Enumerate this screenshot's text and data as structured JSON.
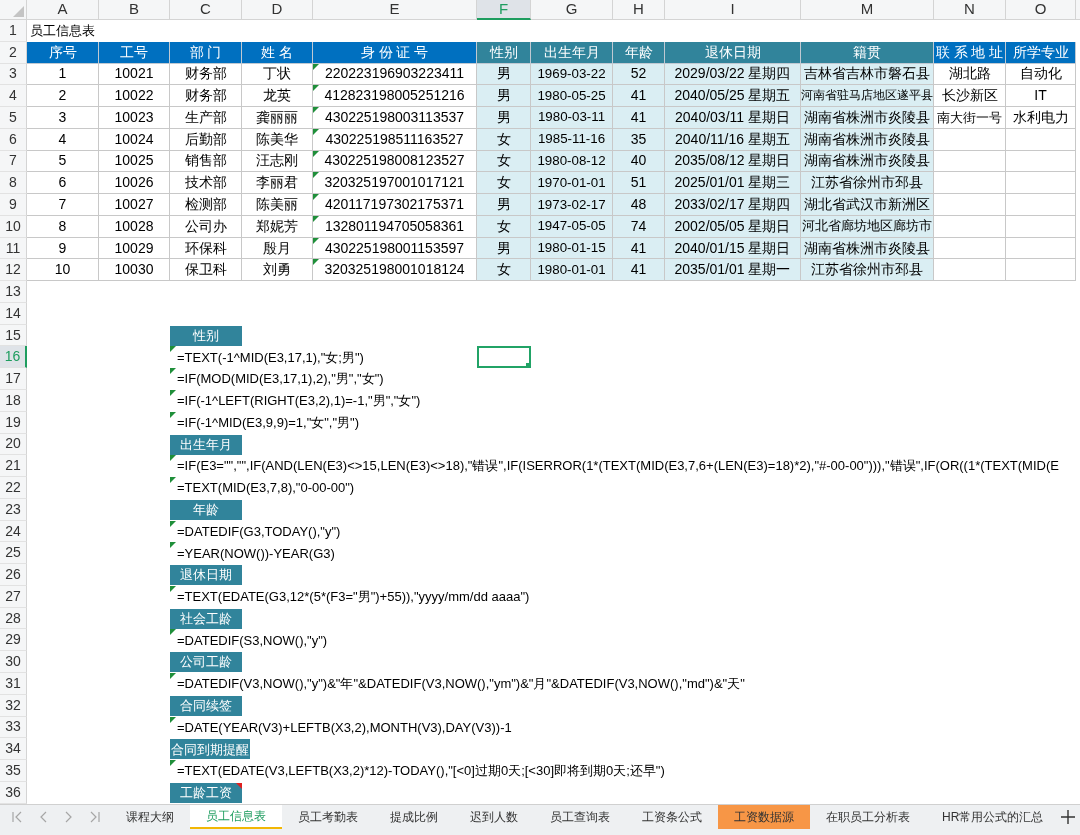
{
  "column_headers": [
    {
      "label": "A",
      "selected": false
    },
    {
      "label": "B",
      "selected": false
    },
    {
      "label": "C",
      "selected": false
    },
    {
      "label": "D",
      "selected": false
    },
    {
      "label": "E",
      "selected": false
    },
    {
      "label": "F",
      "selected": true
    },
    {
      "label": "G",
      "selected": false
    },
    {
      "label": "H",
      "selected": false
    },
    {
      "label": "I",
      "selected": false
    },
    {
      "label": "M",
      "selected": false
    },
    {
      "label": "N",
      "selected": false
    },
    {
      "label": "O",
      "selected": false
    }
  ],
  "row_headers": [
    {
      "label": "1",
      "selected": false
    },
    {
      "label": "2",
      "selected": false
    },
    {
      "label": "3",
      "selected": false
    },
    {
      "label": "4",
      "selected": false
    },
    {
      "label": "5",
      "selected": false
    },
    {
      "label": "6",
      "selected": false
    },
    {
      "label": "7",
      "selected": false
    },
    {
      "label": "8",
      "selected": false
    },
    {
      "label": "9",
      "selected": false
    },
    {
      "label": "10",
      "selected": false
    },
    {
      "label": "11",
      "selected": false
    },
    {
      "label": "12",
      "selected": false
    },
    {
      "label": "13",
      "selected": false
    },
    {
      "label": "14",
      "selected": false
    },
    {
      "label": "15",
      "selected": false
    },
    {
      "label": "16",
      "selected": true
    },
    {
      "label": "17",
      "selected": false
    },
    {
      "label": "18",
      "selected": false
    },
    {
      "label": "19",
      "selected": false
    },
    {
      "label": "20",
      "selected": false
    },
    {
      "label": "21",
      "selected": false
    },
    {
      "label": "22",
      "selected": false
    },
    {
      "label": "23",
      "selected": false
    },
    {
      "label": "24",
      "selected": false
    },
    {
      "label": "25",
      "selected": false
    },
    {
      "label": "26",
      "selected": false
    },
    {
      "label": "27",
      "selected": false
    },
    {
      "label": "28",
      "selected": false
    },
    {
      "label": "29",
      "selected": false
    },
    {
      "label": "30",
      "selected": false
    },
    {
      "label": "31",
      "selected": false
    },
    {
      "label": "32",
      "selected": false
    },
    {
      "label": "33",
      "selected": false
    },
    {
      "label": "34",
      "selected": false
    },
    {
      "label": "35",
      "selected": false
    },
    {
      "label": "36",
      "selected": false
    }
  ],
  "sheet_title": "员工信息表",
  "table": {
    "columns": [
      {
        "label": "序号",
        "kind": "input",
        "flagged": false
      },
      {
        "label": "工号",
        "kind": "input",
        "flagged": false
      },
      {
        "label": "部 门",
        "kind": "input",
        "flagged": false
      },
      {
        "label": "姓 名",
        "kind": "input",
        "flagged": false
      },
      {
        "label": "身 份 证 号",
        "kind": "input",
        "flagged": true
      },
      {
        "label": "性别",
        "kind": "calculated",
        "flagged": false
      },
      {
        "label": "出生年月",
        "kind": "calculated",
        "flagged": false
      },
      {
        "label": "年龄",
        "kind": "calculated",
        "flagged": false
      },
      {
        "label": "退休日期",
        "kind": "calculated",
        "flagged": false
      },
      {
        "label": "籍贯",
        "kind": "calculated",
        "flagged": false
      },
      {
        "label": "联 系 地 址",
        "kind": "input",
        "flagged": false
      },
      {
        "label": "所学专业",
        "kind": "input",
        "flagged": false
      }
    ],
    "rows": [
      {
        "cells": [
          "1",
          "10021",
          "财务部",
          "丁状",
          "220223196903223411",
          "男",
          "1969-03-22",
          "52",
          "2029/03/22 星期四",
          "吉林省吉林市磐石县",
          "湖北路",
          "自动化"
        ]
      },
      {
        "cells": [
          "2",
          "10022",
          "财务部",
          "龙英",
          "412823198005251216",
          "男",
          "1980-05-25",
          "41",
          "2040/05/25 星期五",
          "河南省驻马店地区遂平县",
          "长沙新区",
          "IT"
        ]
      },
      {
        "cells": [
          "3",
          "10023",
          "生产部",
          "龚丽丽",
          "430225198003113537",
          "男",
          "1980-03-11",
          "41",
          "2040/03/11 星期日",
          "湖南省株洲市炎陵县",
          "南大街一号",
          "水利电力"
        ]
      },
      {
        "cells": [
          "4",
          "10024",
          "后勤部",
          "陈美华",
          "430225198511163527",
          "女",
          "1985-11-16",
          "35",
          "2040/11/16 星期五",
          "湖南省株洲市炎陵县"
        ]
      },
      {
        "cells": [
          "5",
          "10025",
          "销售部",
          "汪志刚",
          "430225198008123527",
          "女",
          "1980-08-12",
          "40",
          "2035/08/12 星期日",
          "湖南省株洲市炎陵县"
        ]
      },
      {
        "cells": [
          "6",
          "10026",
          "技术部",
          "李丽君",
          "320325197001017121",
          "女",
          "1970-01-01",
          "51",
          "2025/01/01 星期三",
          "江苏省徐州市邳县"
        ]
      },
      {
        "cells": [
          "7",
          "10027",
          "检测部",
          "陈美丽",
          "420117197302175371",
          "男",
          "1973-02-17",
          "48",
          "2033/02/17 星期四",
          "湖北省武汉市新洲区"
        ]
      },
      {
        "cells": [
          "8",
          "10028",
          "公司办",
          "郑妮芳",
          "132801194705058361",
          "女",
          "1947-05-05",
          "74",
          "2002/05/05 星期日",
          "河北省廊坊地区廊坊市"
        ]
      },
      {
        "cells": [
          "9",
          "10029",
          "环保科",
          "殷月",
          "430225198001153597",
          "男",
          "1980-01-15",
          "41",
          "2040/01/15 星期日",
          "湖南省株洲市炎陵县"
        ]
      },
      {
        "cells": [
          "10",
          "10030",
          "保卫科",
          "刘勇",
          "320325198001018124",
          "女",
          "1980-01-01",
          "41",
          "2035/01/01 星期一",
          "江苏省徐州市邳县"
        ]
      }
    ]
  },
  "formula_sections": [
    {
      "heading": "性别",
      "comment": false,
      "formulas": [
        {
          "text": "=TEXT(-1^MID(E3,17,1),\"女;男\")",
          "flagged": true
        },
        {
          "text": "=IF(MOD(MID(E3,17,1),2),\"男\",\"女\")",
          "flagged": true
        },
        {
          "text": "=IF(-1^LEFT(RIGHT(E3,2),1)=-1,\"男\",\"女\")",
          "flagged": true
        },
        {
          "text": "=IF(-1^MID(E3,9,9)=1,\"女\",\"男\")",
          "flagged": true
        }
      ]
    },
    {
      "heading": "出生年月",
      "comment": false,
      "formulas": [
        {
          "text": "=IF(E3=\"\",\"\",IF(AND(LEN(E3)<>15,LEN(E3)<>18),\"错误\",IF(ISERROR(1*(TEXT(MID(E3,7,6+(LEN(E3)=18)*2),\"#-00-00\"))),\"错误\",IF(OR((1*(TEXT(MID(E",
          "flagged": true
        },
        {
          "text": "=TEXT(MID(E3,7,8),\"0-00-00\")",
          "flagged": true
        }
      ]
    },
    {
      "heading": "年龄",
      "comment": false,
      "formulas": [
        {
          "text": "=DATEDIF(G3,TODAY(),\"y\")",
          "flagged": true
        },
        {
          "text": "=YEAR(NOW())-YEAR(G3)",
          "flagged": true
        }
      ]
    },
    {
      "heading": "退休日期",
      "comment": false,
      "formulas": [
        {
          "text": "=TEXT(EDATE(G3,12*(5*(F3=\"男\")+55)),\"yyyy/mm/dd aaaa\")",
          "flagged": true
        }
      ]
    },
    {
      "heading": "社会工龄",
      "comment": false,
      "formulas": [
        {
          "text": "=DATEDIF(S3,NOW(),\"y\")",
          "flagged": true
        }
      ]
    },
    {
      "heading": "公司工龄",
      "comment": false,
      "formulas": [
        {
          "text": "=DATEDIF(V3,NOW(),\"y\")&\"年\"&DATEDIF(V3,NOW(),\"ym\")&\"月\"&DATEDIF(V3,NOW(),\"md\")&\"天\"",
          "flagged": true
        }
      ]
    },
    {
      "heading": "合同续签",
      "comment": false,
      "formulas": [
        {
          "text": "=DATE(YEAR(V3)+LEFTB(X3,2),MONTH(V3),DAY(V3))-1",
          "flagged": true
        }
      ]
    },
    {
      "heading": "合同到期提醒",
      "comment": false,
      "formulas": [
        {
          "text": "=TEXT(EDATE(V3,LEFTB(X3,2)*12)-TODAY(),\"[<0]过期0天;[<30]即将到期0天;还早\")",
          "flagged": true
        }
      ]
    },
    {
      "heading": "工龄工资",
      "comment": true
    }
  ],
  "sheet_tabs": [
    {
      "label": "课程大纲",
      "selected": false
    },
    {
      "label": "员工信息表",
      "selected": true
    },
    {
      "label": "员工考勤表",
      "selected": false
    },
    {
      "label": "提成比例",
      "selected": false
    },
    {
      "label": "迟到人数",
      "selected": false
    },
    {
      "label": "员工查询表",
      "selected": false
    },
    {
      "label": "工资条公式",
      "selected": false
    },
    {
      "label": "工资数据源",
      "selected": false,
      "color": "#f79646"
    },
    {
      "label": "在职员工分析表",
      "selected": false
    },
    {
      "label": "HR常用公式的汇总",
      "selected": false
    }
  ]
}
